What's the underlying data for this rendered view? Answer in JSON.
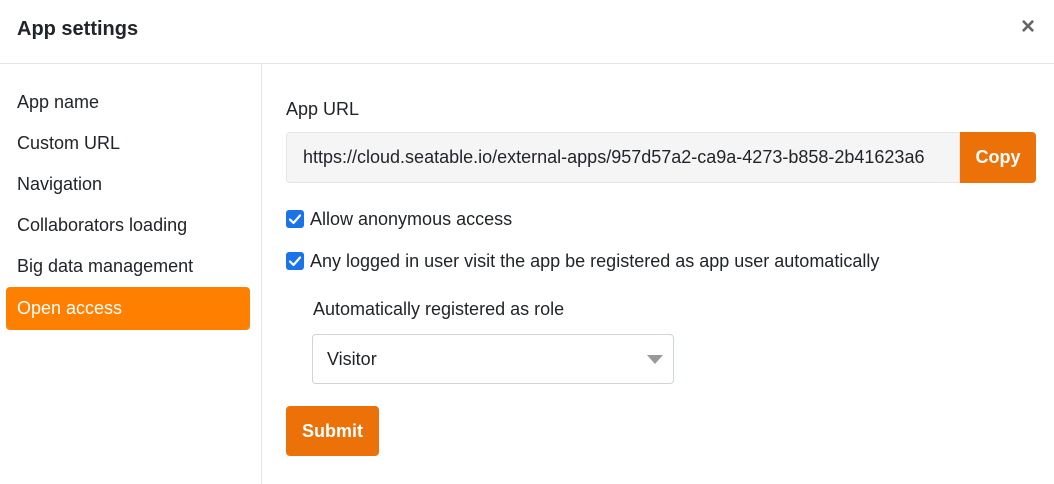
{
  "dialog": {
    "title": "App settings",
    "close_icon": "×"
  },
  "sidebar": {
    "items": [
      {
        "label": "App name",
        "active": false
      },
      {
        "label": "Custom URL",
        "active": false
      },
      {
        "label": "Navigation",
        "active": false
      },
      {
        "label": "Collaborators loading",
        "active": false
      },
      {
        "label": "Big data management",
        "active": false
      },
      {
        "label": "Open access",
        "active": true
      }
    ]
  },
  "main": {
    "app_url_label": "App URL",
    "app_url_value": "https://cloud.seatable.io/external-apps/957d57a2-ca9a-4273-b858-2b41623a6",
    "copy_label": "Copy",
    "allow_anonymous": {
      "label": "Allow anonymous access",
      "checked": true
    },
    "auto_register": {
      "label": "Any logged in user visit the app be registered as app user automatically",
      "checked": true
    },
    "role_label": "Automatically registered as role",
    "role_select": {
      "selected": "Visitor"
    },
    "submit_label": "Submit"
  },
  "colors": {
    "accent": "#ff8000",
    "button": "#ed7109",
    "checkbox": "#1a73e8"
  }
}
